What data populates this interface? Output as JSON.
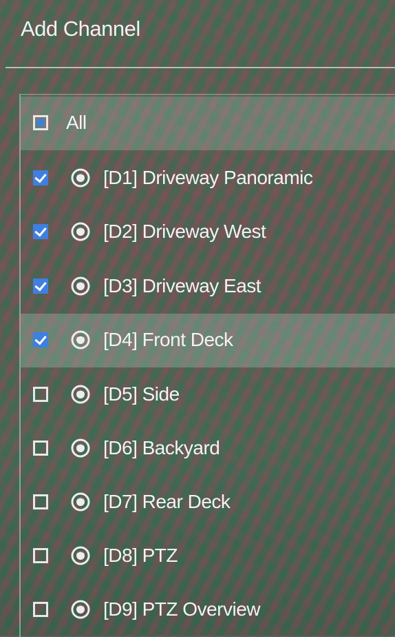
{
  "dialog": {
    "title": "Add Channel"
  },
  "list": {
    "all": {
      "label": "All",
      "checked": false
    },
    "channels": [
      {
        "label": "[D1] Driveway Panoramic",
        "checked": true,
        "icon": "camera-online-icon"
      },
      {
        "label": "[D2] Driveway West",
        "checked": true,
        "icon": "camera-online-icon"
      },
      {
        "label": "[D3] Driveway East",
        "checked": true,
        "icon": "camera-online-icon"
      },
      {
        "label": "[D4] Front Deck",
        "checked": true,
        "icon": "camera-online-icon"
      },
      {
        "label": "[D5] Side",
        "checked": false,
        "icon": "camera-online-icon"
      },
      {
        "label": "[D6] Backyard",
        "checked": false,
        "icon": "camera-online-icon"
      },
      {
        "label": "[D7] Rear Deck",
        "checked": false,
        "icon": "camera-online-icon"
      },
      {
        "label": "[D8] PTZ",
        "checked": false,
        "icon": "camera-online-icon"
      },
      {
        "label": "[D9] PTZ Overview",
        "checked": false,
        "icon": "camera-online-icon"
      }
    ]
  },
  "colors": {
    "checkbox_checked": "#3f7fe0",
    "text": "#f3f3f3"
  }
}
